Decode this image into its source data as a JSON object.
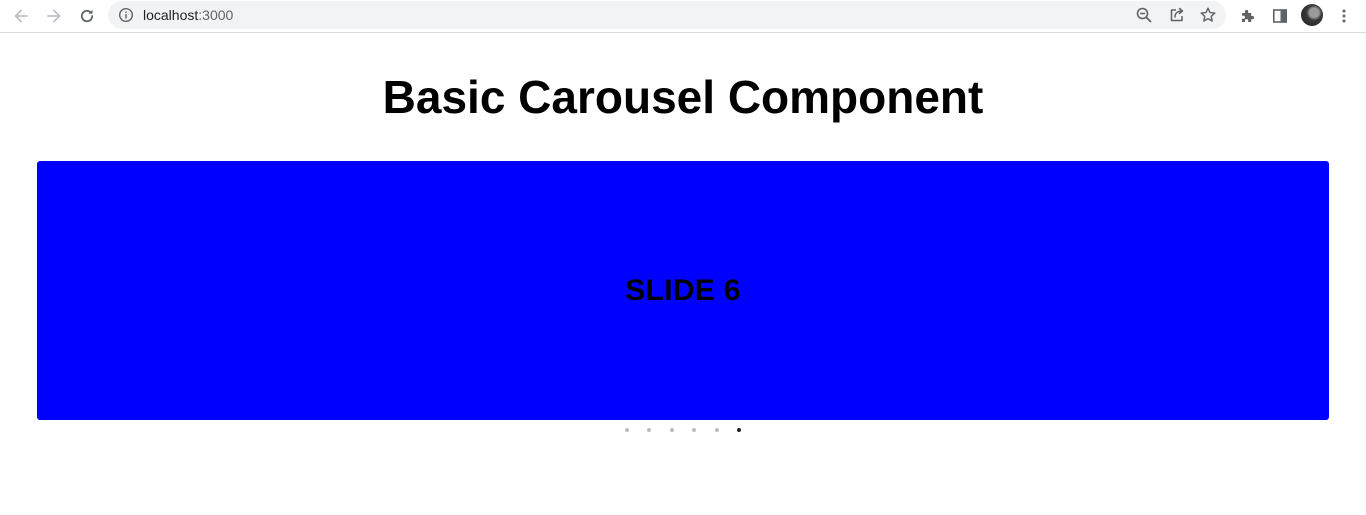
{
  "browser": {
    "url_host": "localhost",
    "url_port": ":3000",
    "icons": {
      "back": "arrow-left-icon",
      "forward": "arrow-right-icon",
      "reload": "reload-icon",
      "site_info": "info-icon",
      "zoom": "zoom-out-icon",
      "share": "share-icon",
      "bookmark": "star-icon",
      "extensions": "puzzle-icon",
      "side_panel": "side-panel-icon",
      "menu": "kebab-menu-icon"
    }
  },
  "page": {
    "title": "Basic Carousel Component"
  },
  "carousel": {
    "current_slide_label": "SLIDE 6",
    "slide_color": "#0000ff",
    "slide_count": 6,
    "active_index": 5
  },
  "colors": {
    "dot_inactive": "#bdbdbd",
    "dot_active": "#222222"
  }
}
